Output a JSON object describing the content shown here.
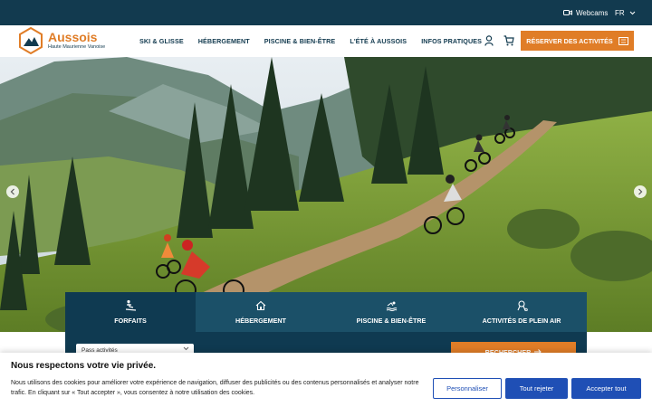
{
  "topbar": {
    "webcams_label": "Webcams",
    "lang_label": "FR"
  },
  "logo": {
    "name": "Aussois",
    "subtitle": "Haute Maurienne Vanoise"
  },
  "nav": {
    "items": [
      {
        "label": "SKI & GLISSE"
      },
      {
        "label": "HÉBERGEMENT"
      },
      {
        "label": "PISCINE & BIEN-ÊTRE"
      },
      {
        "label": "L'ÉTÉ À AUSSOIS"
      },
      {
        "label": "INFOS PRATIQUES"
      }
    ],
    "cta_label": "RÉSERVER DES ACTIVITÉS"
  },
  "search": {
    "tabs": [
      {
        "label": "FORFAITS",
        "icon": "ski-icon"
      },
      {
        "label": "HÉBERGEMENT",
        "icon": "home-icon"
      },
      {
        "label": "PISCINE & BIEN-ÊTRE",
        "icon": "swim-icon"
      },
      {
        "label": "ACTIVITÉS DE PLEIN AIR",
        "icon": "bike-icon"
      }
    ],
    "select_value": "Pass activités",
    "button_label": "RECHERCHER"
  },
  "cookie": {
    "title": "Nous respectons votre vie privée.",
    "text": "Nous utilisons des cookies pour améliorer votre expérience de navigation, diffuser des publicités ou des contenus personnalisés et analyser notre trafic. En cliquant sur « Tout accepter », vous consentez à notre utilisation des cookies.",
    "customize_label": "Personnaliser",
    "reject_label": "Tout rejeter",
    "accept_label": "Accepter tout"
  },
  "colors": {
    "navy": "#123a4f",
    "orange": "#e07d27",
    "blue": "#1f4fb5"
  }
}
